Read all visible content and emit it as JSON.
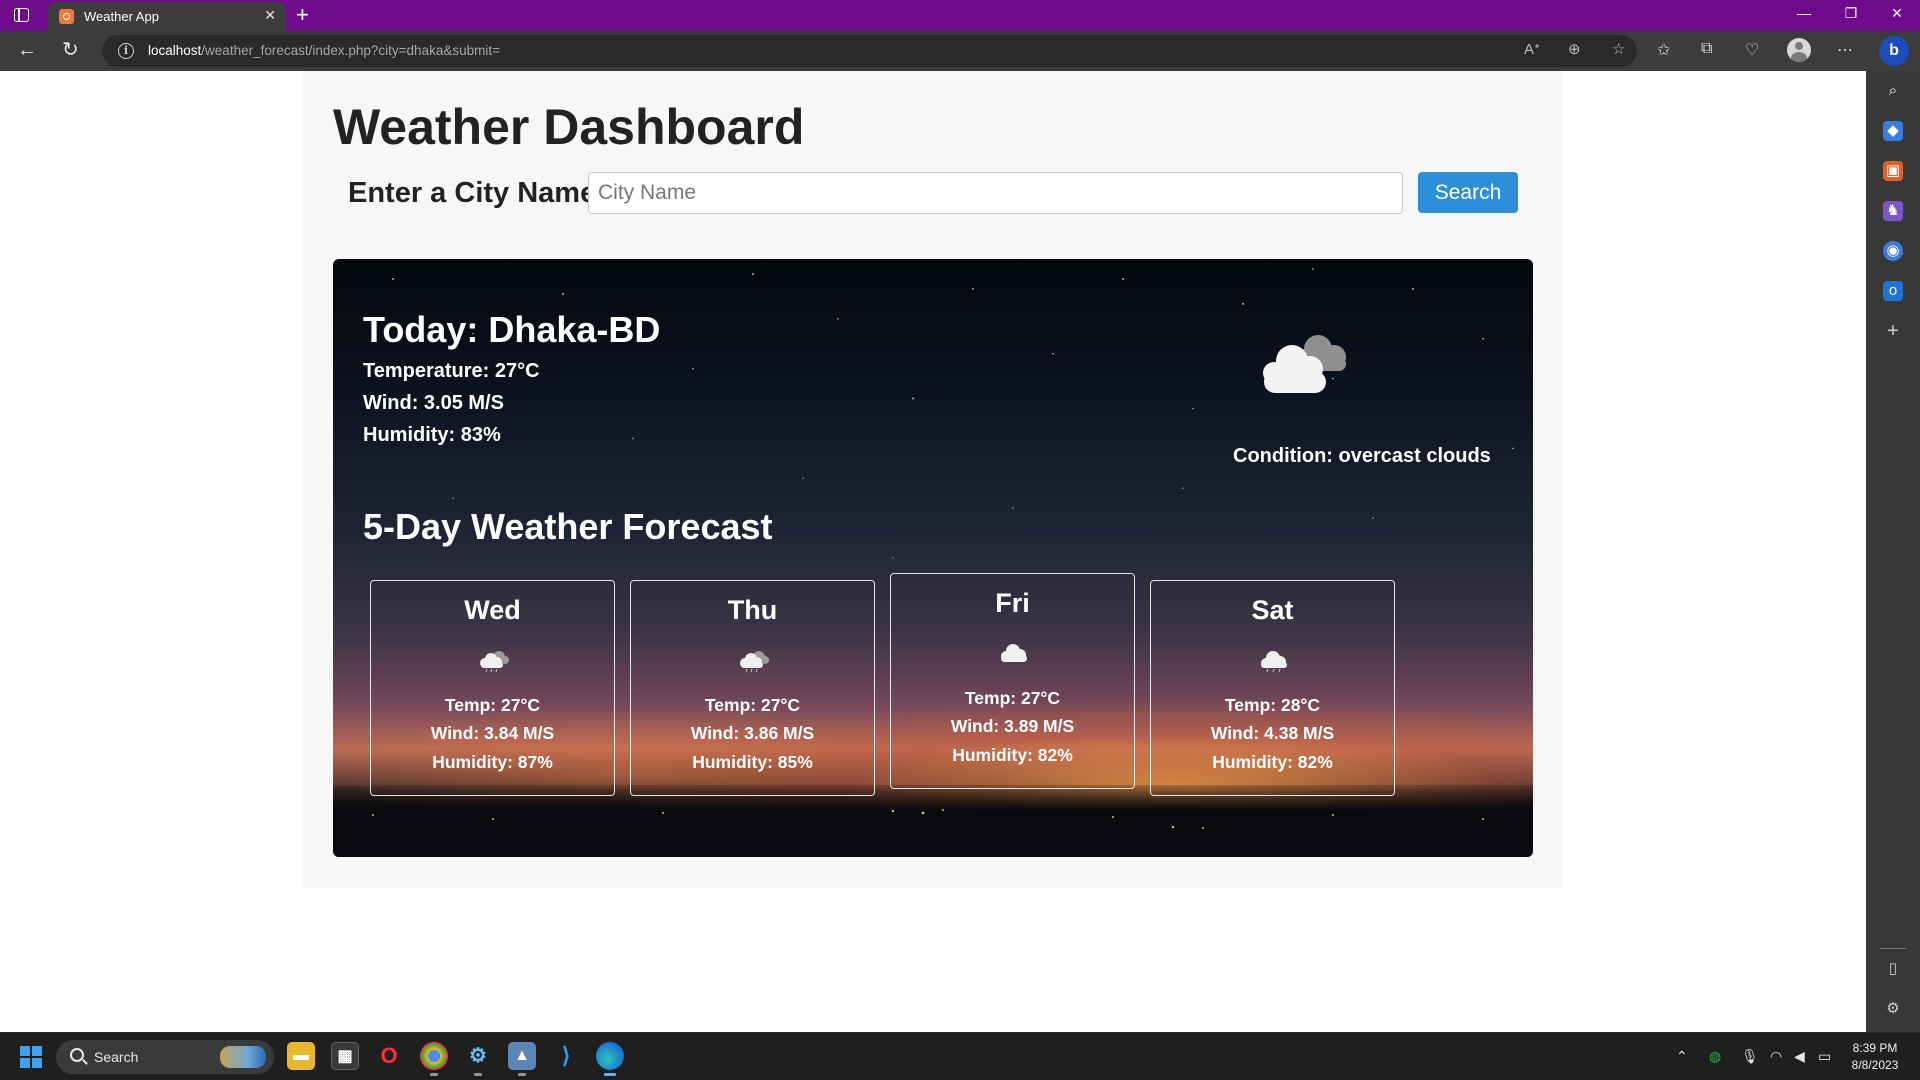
{
  "browser": {
    "tab_title": "Weather App",
    "tab_close": "✕",
    "new_tab": "+",
    "url_host": "localhost",
    "url_path": "/weather_forecast/index.php?city=dhaka&submit=",
    "window_controls": {
      "minimize": "—",
      "restore": "❐",
      "close": "✕"
    }
  },
  "page": {
    "title": "Weather Dashboard",
    "city_label": "Enter a City Name",
    "city_input": {
      "value": "",
      "placeholder": "City Name"
    },
    "search_label": "Search"
  },
  "today": {
    "title": "Today: Dhaka-BD",
    "temperature": "Temperature: 27°C",
    "wind": "Wind: 3.05 M/S",
    "humidity": "Humidity: 83%",
    "condition": "Condition: overcast clouds",
    "condition_icon": "overcast-clouds-icon"
  },
  "forecast": {
    "title": "5-Day Weather Forecast",
    "days": [
      {
        "name": "Wed",
        "icon": "rain-cloud-icon",
        "temp": "Temp: 27°C",
        "wind": "Wind: 3.84 M/S",
        "humidity": "Humidity: 87%"
      },
      {
        "name": "Thu",
        "icon": "rain-cloud-icon",
        "temp": "Temp: 27°C",
        "wind": "Wind: 3.86 M/S",
        "humidity": "Humidity: 85%"
      },
      {
        "name": "Fri",
        "icon": "cloud-icon",
        "temp": "Temp: 27°C",
        "wind": "Wind: 3.89 M/S",
        "humidity": "Humidity: 82%"
      },
      {
        "name": "Sat",
        "icon": "rain-cloud-icon",
        "temp": "Temp: 28°C",
        "wind": "Wind: 4.38 M/S",
        "humidity": "Humidity: 82%"
      }
    ]
  },
  "taskbar": {
    "search_label": "Search",
    "time": "8:39 PM",
    "date": "8/8/2023"
  },
  "colors": {
    "tab_bar": "#6f0a8c",
    "search_button": "#2d8fd9",
    "accent_copilot": "#1b4dbd"
  }
}
